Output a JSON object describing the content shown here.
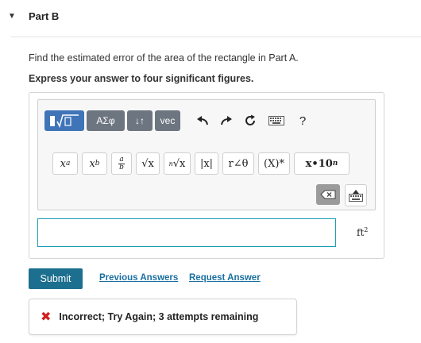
{
  "part": {
    "caret": "▼",
    "title": "Part B"
  },
  "question": {
    "text": "Find the estimated error of the area of the rectangle in Part A.",
    "instruction": "Express your answer to four significant figures."
  },
  "toolbar": {
    "greek_label": "ΑΣφ",
    "arrows_label": "↓↑",
    "vec_label": "vec",
    "help_label": "?"
  },
  "math_palette": {
    "sup_base": "x",
    "sup_exp": "a",
    "sub_base": "x",
    "sub_idx": "b",
    "frac_num": "a",
    "frac_den": "b",
    "sqrt_label": "√x",
    "nroot_idx": "n",
    "nroot_label": "√x",
    "abs_label": "|x|",
    "polar_label": "r∠θ",
    "conj_label": "(X)*",
    "sci_base": "x•10",
    "sci_exp": "n"
  },
  "answer": {
    "value": "",
    "unit_base": "ft",
    "unit_exp": "2"
  },
  "actions": {
    "submit": "Submit",
    "previous_answers": "Previous Answers",
    "request_answer": "Request Answer"
  },
  "feedback": {
    "text": "Incorrect; Try Again; 3 attempts remaining"
  },
  "colors": {
    "accent": "#1c6f8f",
    "input_border": "#1a9db3",
    "error": "#d21f1f",
    "toolbar_blue": "#3f74b8",
    "toolbar_gray": "#6d7680"
  }
}
